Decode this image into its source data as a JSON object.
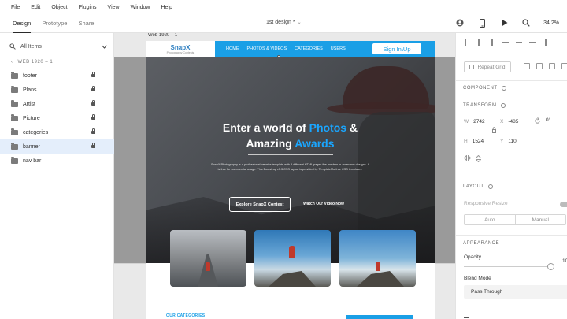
{
  "menu": [
    "File",
    "Edit",
    "Object",
    "Plugins",
    "View",
    "Window",
    "Help"
  ],
  "modes": [
    "Design",
    "Prototype",
    "Share"
  ],
  "doc_title": "1st design *",
  "zoom": "34.2%",
  "left": {
    "search_placeholder": "All Items",
    "breadcrumb": "WEB 1920 – 1",
    "layers": [
      "footer",
      "Plans",
      "Artist",
      "Picture",
      "categories",
      "banner",
      "nav bar"
    ]
  },
  "canvas": {
    "artboard_label": "Web 1920 – 1",
    "site": {
      "logo_title": "SnapX",
      "logo_sub": "Photography Contests",
      "nav": [
        "HOME",
        "PHOTOS & VIDEOS",
        "CATEGORIES",
        "USERS"
      ],
      "sign_button": "Sign In\\Up",
      "hero_line1_a": "Enter a world of ",
      "hero_line1_b": "Photos",
      "hero_line1_c": " &",
      "hero_line2_a": "Amazing ",
      "hero_line2_b": "Awards",
      "paragraph": "SnapX Photography is a professional website template with 3 different HTML pages the masters in awesome designs. It is free for commercial usage. This Bootstrap v5.3 CSS layout is provided by TemplateMo free CSS templates.",
      "explore_button": "Explore SnapX Contest",
      "watch_link": "Watch Our Video Now",
      "our_categories": "OUR CATEGORIES"
    }
  },
  "right": {
    "repeat_grid": "Repeat Grid",
    "component_label": "COMPONENT",
    "transform_label": "TRANSFORM",
    "w_label": "W",
    "w_value": "2742",
    "x_label": "X",
    "x_value": "-485",
    "rotation_value": "0°",
    "h_label": "H",
    "h_value": "1524",
    "y_label": "Y",
    "y_value": "110",
    "layout_label": "LAYOUT",
    "responsive_resize": "Responsive Resize",
    "auto": "Auto",
    "manual": "Manual",
    "appearance_label": "APPEARANCE",
    "opacity_label": "Opacity",
    "opacity_value": "10",
    "blend_label": "Blend Mode",
    "blend_value": "Pass Through"
  }
}
